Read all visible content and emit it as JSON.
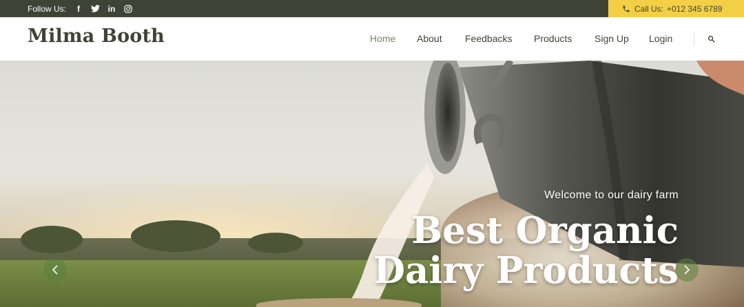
{
  "topbar": {
    "follow_label": "Follow Us:",
    "social": [
      {
        "icon": "facebook-icon",
        "glyph": "f"
      },
      {
        "icon": "twitter-icon",
        "glyph": ""
      },
      {
        "icon": "linkedin-icon",
        "glyph": "in"
      },
      {
        "icon": "instagram-icon",
        "glyph": ""
      }
    ],
    "call_label": "Call Us:",
    "phone": "+012 345 6789",
    "bar_color": "#3f4336",
    "call_bg": "#f3cf45"
  },
  "navbar": {
    "brand": "Milma Booth",
    "items": [
      {
        "label": "Home",
        "active": true
      },
      {
        "label": "About",
        "active": false
      },
      {
        "label": "Feedbacks",
        "active": false
      },
      {
        "label": "Products",
        "active": false
      },
      {
        "label": "Sign Up",
        "active": false
      },
      {
        "label": "Login",
        "active": false
      }
    ],
    "search_icon": "search-icon",
    "active_color": "#6a8f5a"
  },
  "hero": {
    "subtitle": "Welcome to our dairy farm",
    "title_line1": "Best Organic",
    "title_line2": "Dairy Products",
    "prev_icon": "chevron-left-icon",
    "next_icon": "chevron-right-icon"
  }
}
